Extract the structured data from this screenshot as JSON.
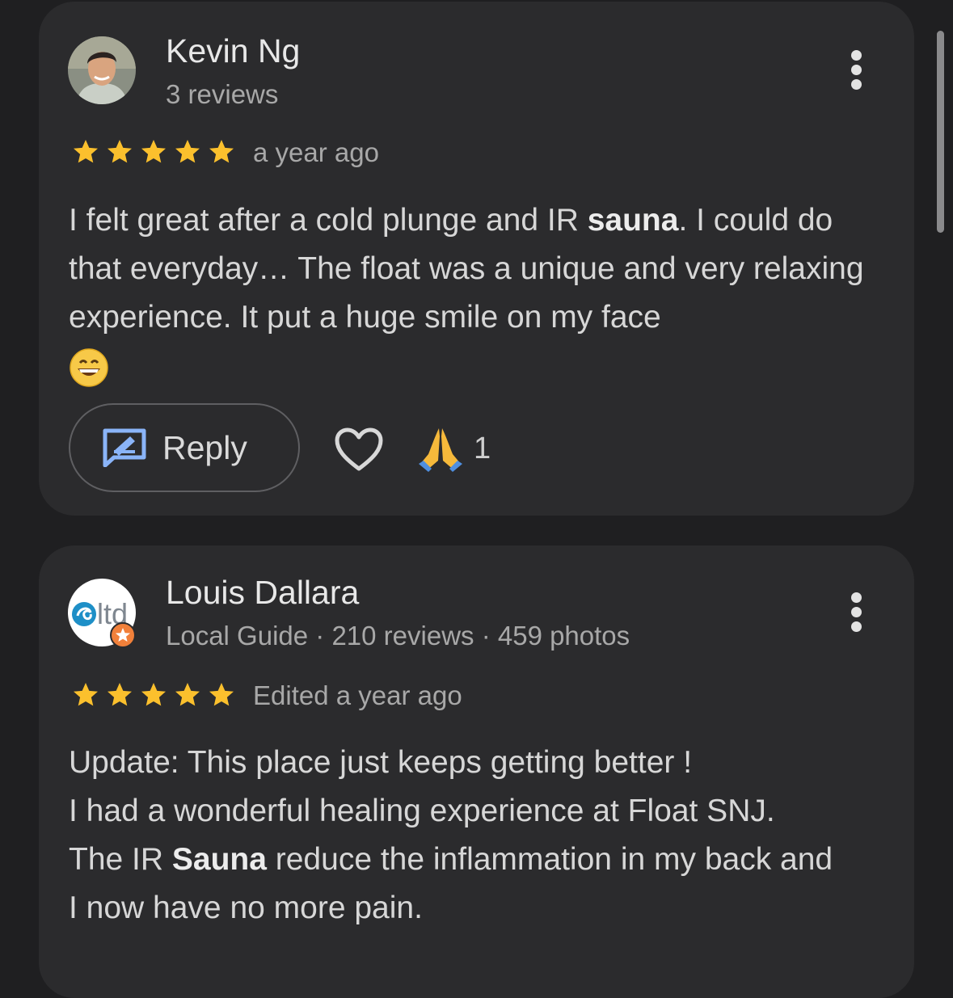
{
  "reviews": [
    {
      "name": "Kevin Ng",
      "meta": "3 reviews",
      "rating": 5,
      "time": "a year ago",
      "body": {
        "p1": "I felt great after a cold plunge and IR ",
        "bold1": "sauna",
        "p2": ". I could do that everyday… The float was a unique and very relaxing experience. It put a huge smile on my face"
      },
      "actions": {
        "reply_label": "Reply",
        "reaction_count": "1"
      },
      "icons": {
        "avatar": "user-photo",
        "menu": "more-vert-icon",
        "reply": "reply-icon",
        "like": "heart-icon",
        "reaction": "folded-hands-emoji",
        "trailing_emoji": "grinning-face-emoji"
      }
    },
    {
      "name": "Louis Dallara",
      "meta": "Local Guide · 210 reviews · 459 photos",
      "rating": 5,
      "time": "Edited a year ago",
      "body": {
        "l1": "Update: This place just keeps getting better !",
        "l2": "I had a wonderful healing experience at Float SNJ.",
        "l3a": "The IR ",
        "l3b": "Sauna",
        "l3c": " reduce the inflammation in my back and I now have no more pain."
      },
      "avatar_text": "ltd",
      "icons": {
        "avatar": "ltd-logo",
        "badge": "local-guide-badge",
        "menu": "more-vert-icon"
      }
    }
  ],
  "colors": {
    "background": "#1f1f21",
    "card": "#2b2b2d",
    "star": "#fbc02d",
    "reply_icon": "#8ab4f8"
  }
}
